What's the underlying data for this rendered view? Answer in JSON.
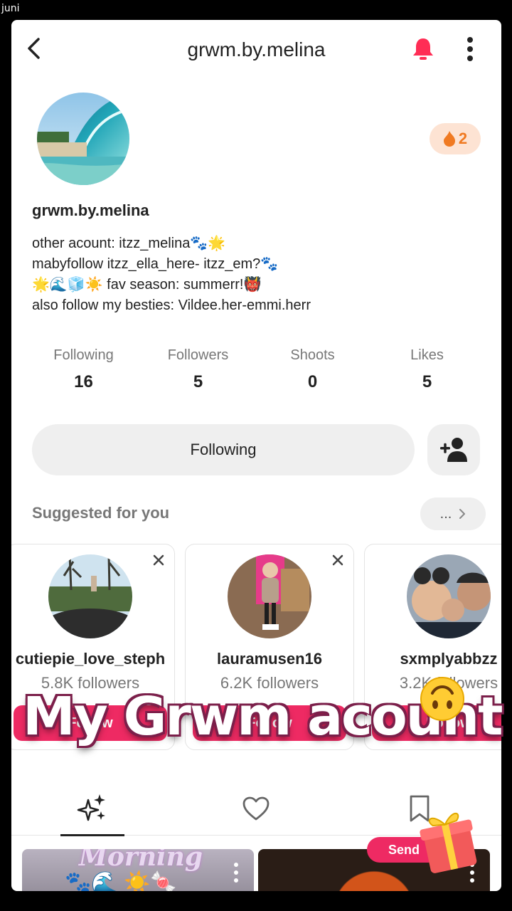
{
  "corner_label": "juni",
  "header": {
    "title": "grwm.by.melina"
  },
  "streak": {
    "count": "2"
  },
  "profile": {
    "username": "grwm.by.melina",
    "bio": [
      "other acount: itzz_melina🐾🌟",
      "mabyfollow itzz_ella_here- itzz_em?🐾",
      "🌟🌊🧊☀️ fav season: summerr!👹",
      "also follow my besties: Vildee.her-emmi.herr"
    ]
  },
  "stats": [
    {
      "label": "Following",
      "value": "16"
    },
    {
      "label": "Followers",
      "value": "5"
    },
    {
      "label": "Shoots",
      "value": "0"
    },
    {
      "label": "Likes",
      "value": "5"
    }
  ],
  "actions": {
    "following_label": "Following"
  },
  "suggested": {
    "title": "Suggested for you",
    "more_label": "...",
    "cards": [
      {
        "name": "cutiepie_love_steph",
        "followers": "5.8K followers",
        "button": "Follow"
      },
      {
        "name": "lauramusen16",
        "followers": "6.2K followers",
        "button": "Follow"
      },
      {
        "name": "sxmplyabbzz",
        "followers": "3.2K followers",
        "button": "Follow"
      }
    ]
  },
  "overlay": {
    "caption": "My Grwm acount"
  },
  "tabs": [
    {
      "icon": "sparkles-icon",
      "active": true
    },
    {
      "icon": "heart-icon",
      "active": false
    },
    {
      "icon": "bookmark-icon",
      "active": false
    }
  ],
  "grid": {
    "first_caption": "Morning",
    "send_label": "Send"
  },
  "colors": {
    "accent": "#ee2a63",
    "bell": "#ff2d55",
    "streak_bg": "#fde3d3",
    "streak_fg": "#f07a22"
  }
}
